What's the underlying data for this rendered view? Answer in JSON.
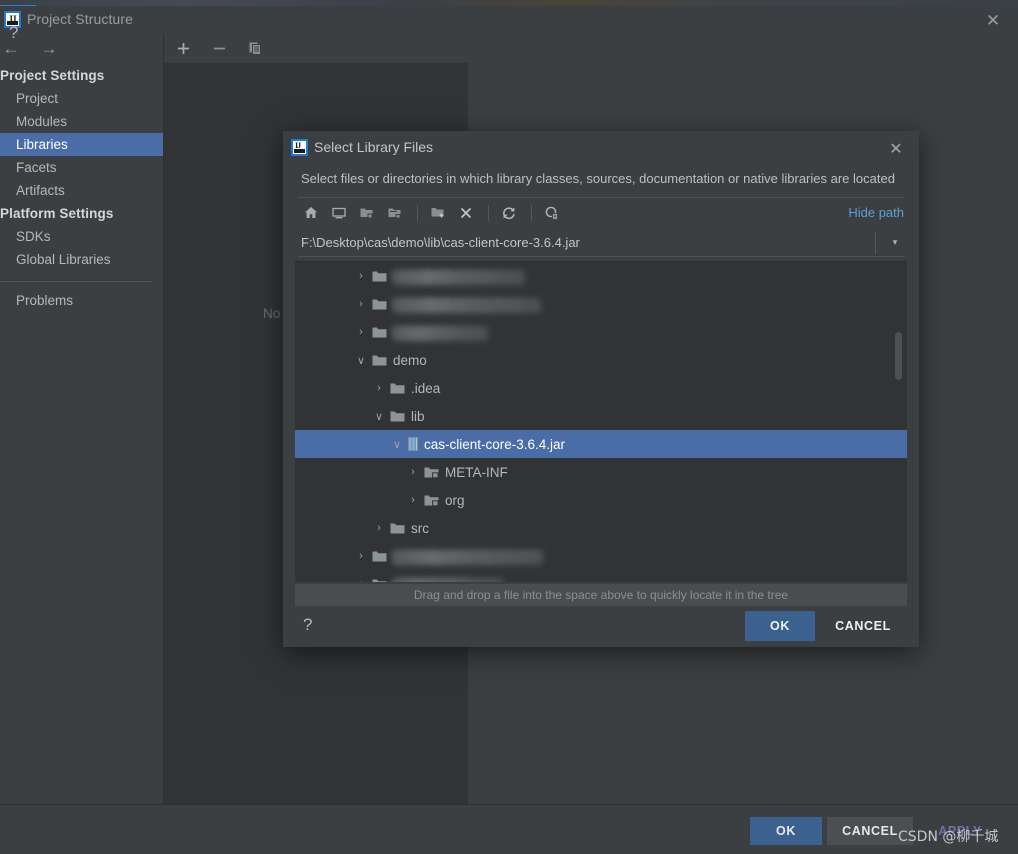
{
  "window": {
    "title": "Project Structure",
    "app_icon": "intellij-idea-icon",
    "close_label": "✕",
    "nav_back": "←",
    "nav_forward": "→",
    "help_label": "?",
    "empty_text": "No",
    "sidebar": {
      "groups": [
        {
          "label": "Project Settings",
          "items": [
            {
              "label": "Project",
              "selected": false
            },
            {
              "label": "Modules",
              "selected": false
            },
            {
              "label": "Libraries",
              "selected": true
            },
            {
              "label": "Facets",
              "selected": false
            },
            {
              "label": "Artifacts",
              "selected": false
            }
          ]
        },
        {
          "label": "Platform Settings",
          "items": [
            {
              "label": "SDKs",
              "selected": false
            },
            {
              "label": "Global Libraries",
              "selected": false
            }
          ]
        }
      ],
      "extra_items": [
        {
          "label": "Problems",
          "selected": false
        }
      ]
    },
    "toolbar": [
      {
        "name": "add-button",
        "glyph": "+"
      },
      {
        "name": "remove-button",
        "glyph": "−"
      },
      {
        "name": "copy-button",
        "glyph": "copy-icon"
      }
    ],
    "footer_buttons": [
      {
        "label": "OK",
        "name": "ok-button",
        "style": "primary"
      },
      {
        "label": "CANCEL",
        "name": "cancel-button",
        "style": "default"
      },
      {
        "label": "APPLY",
        "name": "apply-button",
        "style": "link"
      }
    ]
  },
  "dialog": {
    "title": "Select Library Files",
    "icon": "intellij-idea-icon",
    "close_label": "✕",
    "description": "Select files or directories in which library classes, sources, documentation or native libraries are located",
    "toolbar": [
      {
        "name": "home-icon",
        "tooltip": "Home"
      },
      {
        "name": "desktop-icon",
        "tooltip": "Desktop"
      },
      {
        "name": "expand-all-icon",
        "tooltip": "Expand All"
      },
      {
        "name": "collapse-all-icon",
        "tooltip": "Collapse All"
      },
      {
        "name": "new-folder-icon",
        "tooltip": "New Folder"
      },
      {
        "name": "delete-icon",
        "tooltip": "Delete"
      },
      {
        "name": "refresh-icon",
        "tooltip": "Refresh"
      },
      {
        "name": "show-hidden-icon",
        "tooltip": "Show Hidden Files"
      }
    ],
    "hide_path_label": "Hide path",
    "path_value": "F:\\Desktop\\cas\\demo\\lib\\cas-client-core-3.6.4.jar",
    "path_placeholder": "",
    "path_dropdown_glyph": "▾",
    "tree": [
      {
        "label": "",
        "redacted": true,
        "redact_width": 132,
        "ghost": "cas-client-xxxxxx",
        "indent": 60,
        "twist": "›",
        "icon": "folder-icon",
        "selected": false
      },
      {
        "label": "",
        "redacted": true,
        "redact_width": 148,
        "ghost": "cas-client-spring-boot",
        "indent": 60,
        "twist": "›",
        "icon": "folder-icon",
        "selected": false
      },
      {
        "label": "",
        "redacted": true,
        "redact_width": 95,
        "ghost": "cas-server",
        "indent": 60,
        "twist": "›",
        "icon": "folder-icon",
        "selected": false
      },
      {
        "label": "demo",
        "redacted": false,
        "indent": 60,
        "twist": "∨",
        "icon": "folder-icon",
        "selected": false
      },
      {
        "label": ".idea",
        "redacted": false,
        "indent": 78,
        "twist": "›",
        "icon": "folder-icon",
        "selected": false
      },
      {
        "label": "lib",
        "redacted": false,
        "indent": 78,
        "twist": "∨",
        "icon": "folder-icon",
        "selected": false
      },
      {
        "label": "cas-client-core-3.6.4.jar",
        "redacted": false,
        "indent": 96,
        "twist": "∨",
        "icon": "jar-icon",
        "selected": true
      },
      {
        "label": "META-INF",
        "redacted": false,
        "indent": 112,
        "twist": "›",
        "icon": "folder-jar-icon",
        "selected": false
      },
      {
        "label": "org",
        "redacted": false,
        "indent": 112,
        "twist": "›",
        "icon": "folder-jar-icon",
        "selected": false
      },
      {
        "label": "src",
        "redacted": false,
        "indent": 78,
        "twist": "›",
        "icon": "folder-icon",
        "selected": false
      },
      {
        "label": "",
        "redacted": true,
        "redact_width": 150,
        "ghost": "gateway-security-master",
        "indent": 60,
        "twist": "›",
        "icon": "folder-icon",
        "selected": false
      },
      {
        "label": "",
        "redacted": true,
        "redact_width": 110,
        "ghost": "nginx-1.18.0",
        "indent": 60,
        "twist": "›",
        "icon": "folder-icon",
        "selected": false
      }
    ],
    "hint": "Drag and drop a file into the space above to quickly locate it in the tree",
    "help_label": "?",
    "buttons": [
      {
        "label": "OK",
        "name": "ok-button",
        "style": "primary"
      },
      {
        "label": "CANCEL",
        "name": "cancel-button",
        "style": "default"
      }
    ]
  },
  "watermark": {
    "text": "CSDN @柳千城"
  },
  "colors": {
    "accent_blue": "#4a6da7",
    "primary_button": "#3b628e",
    "link_blue": "#5c9fd6",
    "panel_bg": "#3c3f41",
    "tree_bg": "#313335",
    "text": "#b6b7b8"
  }
}
